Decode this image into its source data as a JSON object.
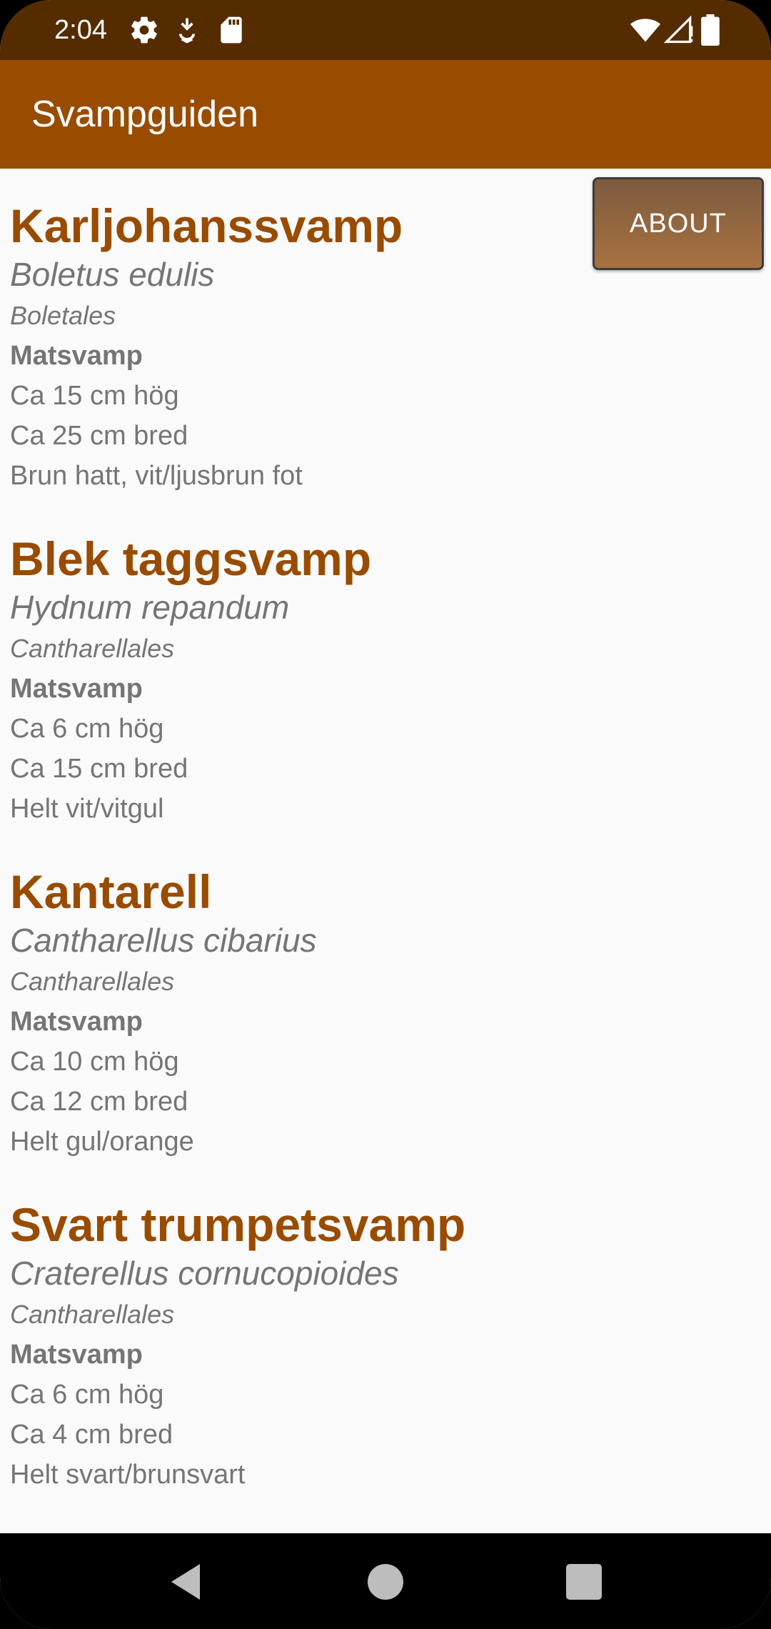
{
  "status_bar": {
    "time": "2:04",
    "icons": [
      "gear-icon",
      "debug-icon",
      "sd-card-icon",
      "wifi-icon",
      "signal-icon",
      "battery-icon"
    ]
  },
  "app_bar": {
    "title": "Svampguiden"
  },
  "about_button": {
    "label": "ABOUT"
  },
  "mushrooms": [
    {
      "name": "Karljohanssvamp",
      "latin": "Boletus edulis",
      "order": "Boletales",
      "type": "Matsvamp",
      "height": "Ca 15 cm hög",
      "width": "Ca 25 cm bred",
      "description": "Brun hatt, vit/ljusbrun fot"
    },
    {
      "name": "Blek taggsvamp",
      "latin": "Hydnum repandum",
      "order": "Cantharellales",
      "type": "Matsvamp",
      "height": "Ca 6 cm hög",
      "width": "Ca 15 cm bred",
      "description": "Helt vit/vitgul"
    },
    {
      "name": "Kantarell",
      "latin": "Cantharellus cibarius",
      "order": "Cantharellales",
      "type": "Matsvamp",
      "height": "Ca 10 cm hög",
      "width": "Ca 12 cm bred",
      "description": "Helt gul/orange"
    },
    {
      "name": "Svart trumpetsvamp",
      "latin": "Craterellus cornucopioides",
      "order": "Cantharellales",
      "type": "Matsvamp",
      "height": "Ca 6 cm hög",
      "width": "Ca 4 cm bred",
      "description": "Helt svart/brunsvart"
    }
  ],
  "nav_bar": {
    "icons": [
      "back-icon",
      "home-icon",
      "recents-icon"
    ]
  },
  "colors": {
    "status_bar": "#552c00",
    "app_bar": "#994c00",
    "accent_text": "#994c00",
    "body_text": "#757575",
    "background": "#fafafa"
  }
}
